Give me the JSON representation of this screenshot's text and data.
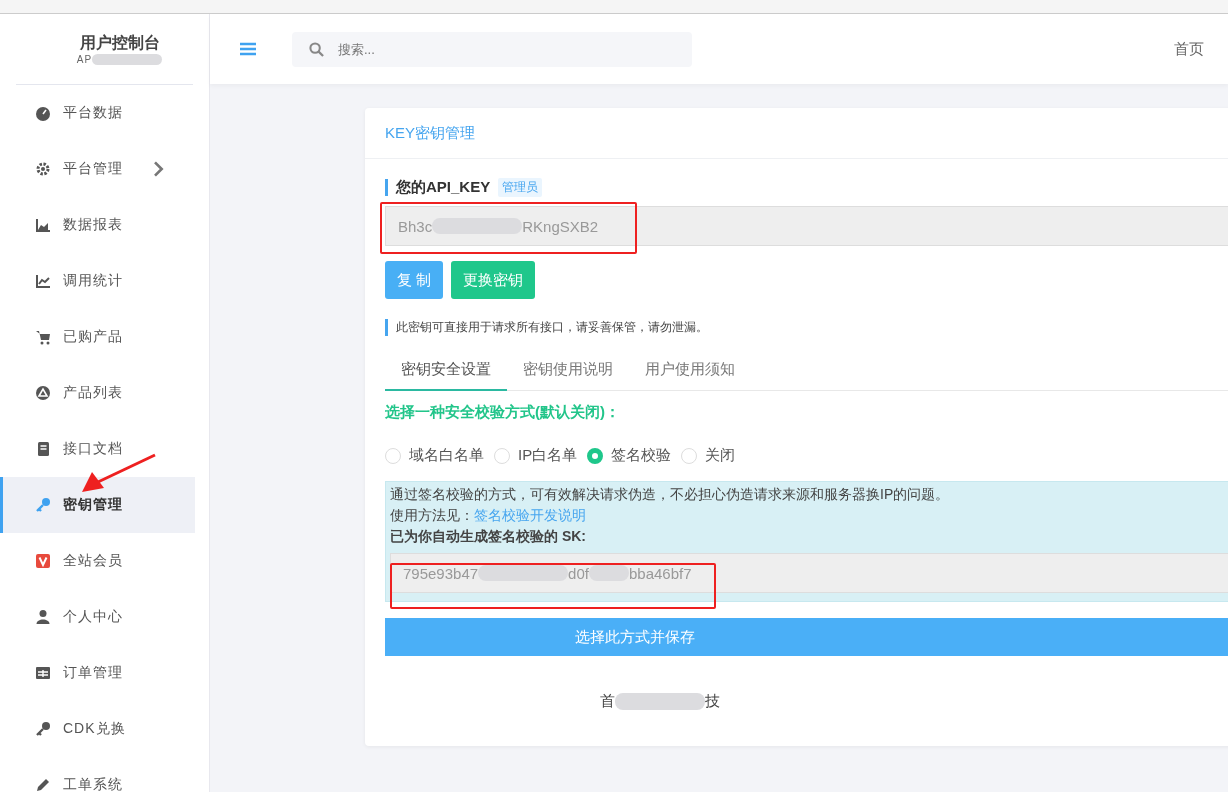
{
  "sidebar": {
    "title": "用户控制台",
    "subtitle": "AP",
    "items": [
      {
        "label": "平台数据",
        "selected": false,
        "expandable": false
      },
      {
        "label": "平台管理",
        "selected": false,
        "expandable": true
      },
      {
        "label": "数据报表",
        "selected": false,
        "expandable": false
      },
      {
        "label": "调用统计",
        "selected": false,
        "expandable": false
      },
      {
        "label": "已购产品",
        "selected": false,
        "expandable": false
      },
      {
        "label": "产品列表",
        "selected": false,
        "expandable": false
      },
      {
        "label": "接口文档",
        "selected": false,
        "expandable": false
      },
      {
        "label": "密钥管理",
        "selected": true,
        "expandable": false
      },
      {
        "label": "全站会员",
        "selected": false,
        "expandable": false
      },
      {
        "label": "个人中心",
        "selected": false,
        "expandable": false
      },
      {
        "label": "订单管理",
        "selected": false,
        "expandable": false
      },
      {
        "label": "CDK兑换",
        "selected": false,
        "expandable": false
      },
      {
        "label": "工单系统",
        "selected": false,
        "expandable": false
      }
    ]
  },
  "header": {
    "search": {
      "placeholder": "搜索..."
    },
    "home_link": "首页"
  },
  "card": {
    "title": "KEY密钥管理",
    "api_key": {
      "label": "您的API_KEY",
      "badge": "管理员",
      "value_parts": [
        "Bh3c",
        "RKngSXB2"
      ]
    },
    "buttons": [
      "复 制",
      "更换密钥"
    ],
    "notice": "此密钥可直接用于请求所有接口，请妥善保管，请勿泄漏。",
    "tabs": [
      {
        "label": "密钥安全设置",
        "selected": true
      },
      {
        "label": "密钥使用说明",
        "selected": false
      },
      {
        "label": "用户使用须知",
        "selected": false
      }
    ],
    "prompt": "选择一种安全校验方式(默认关闭)：",
    "options": [
      {
        "label": "域名白名单",
        "selected": false
      },
      {
        "label": "IP白名单",
        "selected": false
      },
      {
        "label": "签名校验",
        "selected": true
      },
      {
        "label": "关闭",
        "selected": false
      }
    ],
    "info": {
      "text": "通过签名校验的方式，可有效解决请求伪造，不必担心伪造请求来源和服务器换IP的问题。",
      "usage_label": "使用方法见：",
      "usage_link": "签名校验开发说明",
      "sk_label": "已为你自动生成签名校验的 SK:",
      "sk_parts": [
        "795e93b47",
        "d0f",
        "bba46bf7"
      ]
    },
    "save_button": "选择此方式并保存",
    "footer_parts": [
      "首",
      "技"
    ]
  }
}
